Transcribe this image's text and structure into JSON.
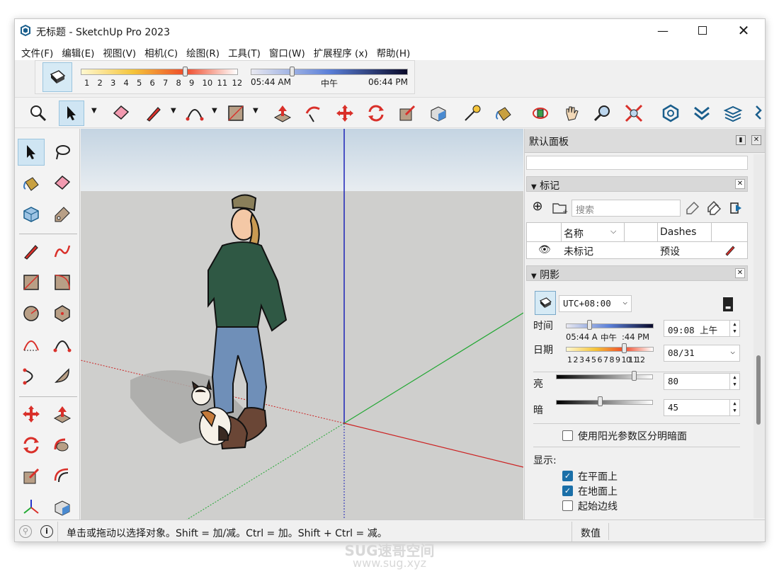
{
  "window": {
    "title": "无标题 - SketchUp Pro 2023"
  },
  "menu": [
    "文件(F)",
    "编辑(E)",
    "视图(V)",
    "相机(C)",
    "绘图(R)",
    "工具(T)",
    "窗口(W)",
    "扩展程序 (x)",
    "帮助(H)"
  ],
  "shadow_toolbar": {
    "months": [
      "1",
      "2",
      "3",
      "4",
      "5",
      "6",
      "7",
      "8",
      "9",
      "10",
      "11",
      "12"
    ],
    "month_level": 0.66,
    "time_start": "05:44 AM",
    "time_mid": "中午",
    "time_end": "06:44 PM",
    "time_level": 0.26
  },
  "panel": {
    "title": "默认面板",
    "tags": {
      "header": "标记",
      "search_placeholder": "搜索",
      "col_name": "名称",
      "col_dashes": "Dashes",
      "row_name": "未标记",
      "row_dashes": "预设"
    },
    "shadows": {
      "header": "阴影",
      "utc": "UTC+08:00",
      "time_label": "时间",
      "time_scale": [
        "05:44 A",
        "中午",
        ":44 PM"
      ],
      "time_value": "09:08  上午",
      "time_level": 0.27,
      "date_label": "日期",
      "date_scale": [
        "1",
        "2",
        "3",
        "4",
        "5",
        "6",
        "7",
        "8",
        "9",
        "10",
        "11",
        "12"
      ],
      "date_value": "08/31",
      "date_level": 0.66,
      "light_label": "亮",
      "light_value": "80",
      "light_level": 0.8,
      "dark_label": "暗",
      "dark_value": "45",
      "dark_level": 0.45,
      "sun_shading": "使用阳光参数区分明暗面",
      "display_label": "显示:",
      "on_faces": "在平面上",
      "on_ground": "在地面上",
      "from_edges": "起始边线"
    }
  },
  "status": {
    "hint": "单击或拖动以选择对象。Shift = 加/减。Ctrl = 加。Shift + Ctrl = 减。",
    "measure_label": "数值"
  },
  "watermark": {
    "line1": "SUG速哥空间",
    "line2": "www.sug.xyz"
  }
}
